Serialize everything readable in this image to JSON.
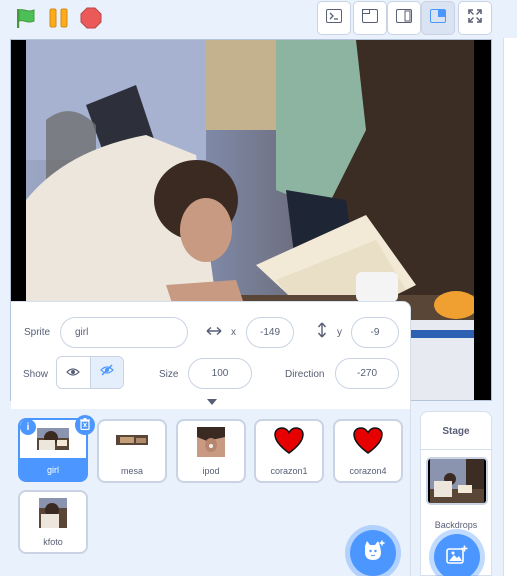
{
  "toolbar": {
    "green_flag": "green-flag",
    "pause": "pause",
    "stop": "stop"
  },
  "sprite_info": {
    "sprite_label": "Sprite",
    "sprite_name": "girl",
    "x_label": "x",
    "x_value": "-149",
    "y_label": "y",
    "y_value": "-9",
    "show_label": "Show",
    "size_label": "Size",
    "size_value": "100",
    "direction_label": "Direction",
    "direction_value": "-270"
  },
  "sprites": [
    {
      "name": "girl",
      "selected": true
    },
    {
      "name": "mesa",
      "selected": false
    },
    {
      "name": "ipod",
      "selected": false
    },
    {
      "name": "corazon1",
      "selected": false
    },
    {
      "name": "corazon4",
      "selected": false
    },
    {
      "name": "kfoto",
      "selected": false
    }
  ],
  "stage_panel": {
    "title": "Stage",
    "backdrops_label": "Backdrops"
  },
  "colors": {
    "accent": "#4c97ff",
    "heart": "#e60000",
    "delete": "#4c97ff"
  }
}
